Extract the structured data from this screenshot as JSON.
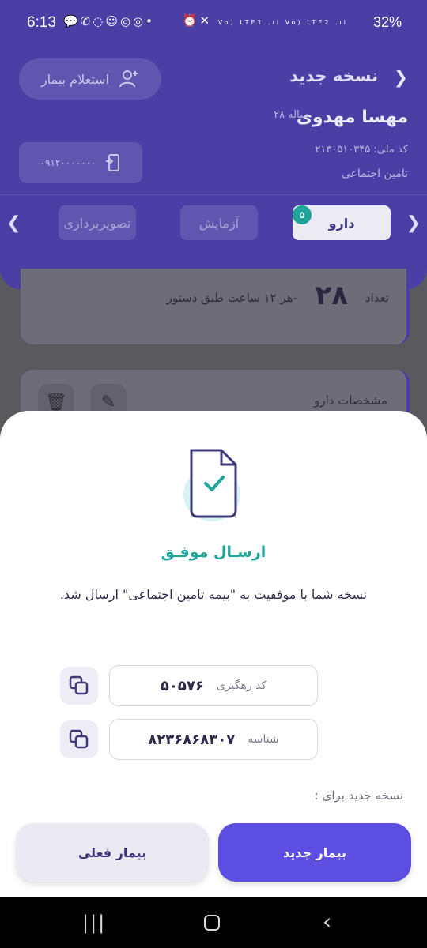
{
  "status_bar": {
    "time": "6:13",
    "left_icons": "💬✆◌☺◎◎•",
    "right_icons": "⏰✕",
    "network": "Vo) LTE1 .ıl Vo) LTE2 .ıl",
    "battery": "32%"
  },
  "header": {
    "title": "نسخه جدید",
    "inquiry_button": "استعلام بیمار",
    "patient_name": "مهسا مهدوی",
    "patient_age": "۲۸ ساله",
    "phone": "۰۹۱۲۰۰۰۰۰۰۰",
    "national_code": "کد ملی: ۲۱۳۰۵۱۰۳۴۵",
    "insurance": "تامین اجتماعی",
    "tabs": [
      {
        "label": "دارو",
        "badge": "۵",
        "active": true
      },
      {
        "label": "آزمایش",
        "active": false
      },
      {
        "label": "تصویربرداری",
        "active": false
      }
    ]
  },
  "drug_card": {
    "quantity_label": "تعداد",
    "quantity_value": "۲۸",
    "dosage": "هر ۱۲ ساعت طبق دستور-"
  },
  "drug_card_2": {
    "spec_label": "مشخصات دارو"
  },
  "sheet": {
    "title": "ارسـال موفـق",
    "message": "نسخه شما با موفقیت به \"بیمه تامین اجتماعی\" ارسال شد.",
    "tracking_label": "کد رهگیری",
    "tracking_value": "۵۰۵۷۶",
    "id_label": "شناسه",
    "id_value": "۸۲۳۶۸۶۸۳۰۷",
    "new_rx_label": "نسخه جدید برای :",
    "new_patient_button": "بیمار جدید",
    "current_patient_button": "بیمار فعلی"
  },
  "colors": {
    "header_bg": "#4b3fa6",
    "accent": "#1fa59a",
    "primary_button": "#5b4ee0"
  }
}
